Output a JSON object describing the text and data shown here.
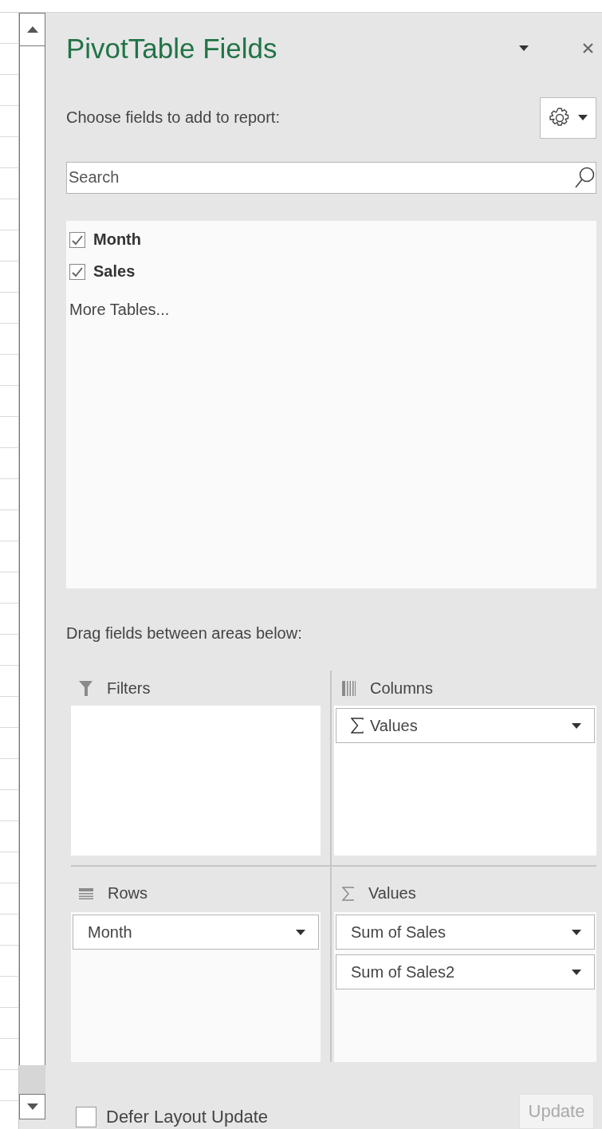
{
  "panel": {
    "title": "PivotTable Fields",
    "instruction": "Choose fields to add to report:",
    "search": {
      "placeholder": "Search"
    },
    "fields": [
      {
        "label": "Month",
        "checked": true
      },
      {
        "label": "Sales",
        "checked": true
      }
    ],
    "more_tables": "More Tables...",
    "areas_hint": "Drag fields between areas below:",
    "areas": [
      {
        "kind": "filters",
        "title": "Filters"
      },
      {
        "kind": "columns",
        "title": "Columns",
        "items": [
          {
            "label": "Values",
            "kind": "values"
          }
        ]
      },
      {
        "kind": "rows",
        "title": "Rows",
        "items": [
          {
            "label": "Month",
            "kind": "field"
          }
        ]
      },
      {
        "kind": "values",
        "title": "Values",
        "items": [
          {
            "label": "Sum of Sales",
            "kind": "field"
          },
          {
            "label": "Sum of Sales2",
            "kind": "field"
          }
        ]
      }
    ],
    "defer": {
      "label": "Defer Layout Update",
      "checked": false
    },
    "update": {
      "label": "Update",
      "disabled": true
    }
  }
}
